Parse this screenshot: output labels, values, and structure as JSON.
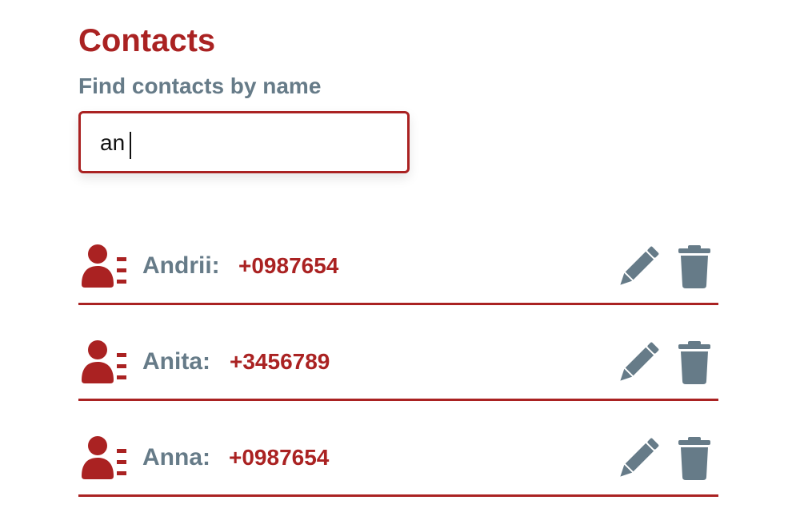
{
  "header": {
    "title": "Contacts"
  },
  "search": {
    "label": "Find contacts by name",
    "value": "an"
  },
  "contacts": [
    {
      "name": "Andrii:",
      "phone": "+0987654",
      "icon": "contact-list-icon"
    },
    {
      "name": "Anita:",
      "phone": "+3456789",
      "icon": "contact-list-icon"
    },
    {
      "name": "Anna:",
      "phone": "+0987654",
      "icon": "contact-list-icon"
    }
  ],
  "actions": {
    "edit_icon": "pencil-icon",
    "delete_icon": "trash-icon"
  },
  "colors": {
    "accent": "#aa2222",
    "muted": "#667b88",
    "background": "#ffffff"
  }
}
